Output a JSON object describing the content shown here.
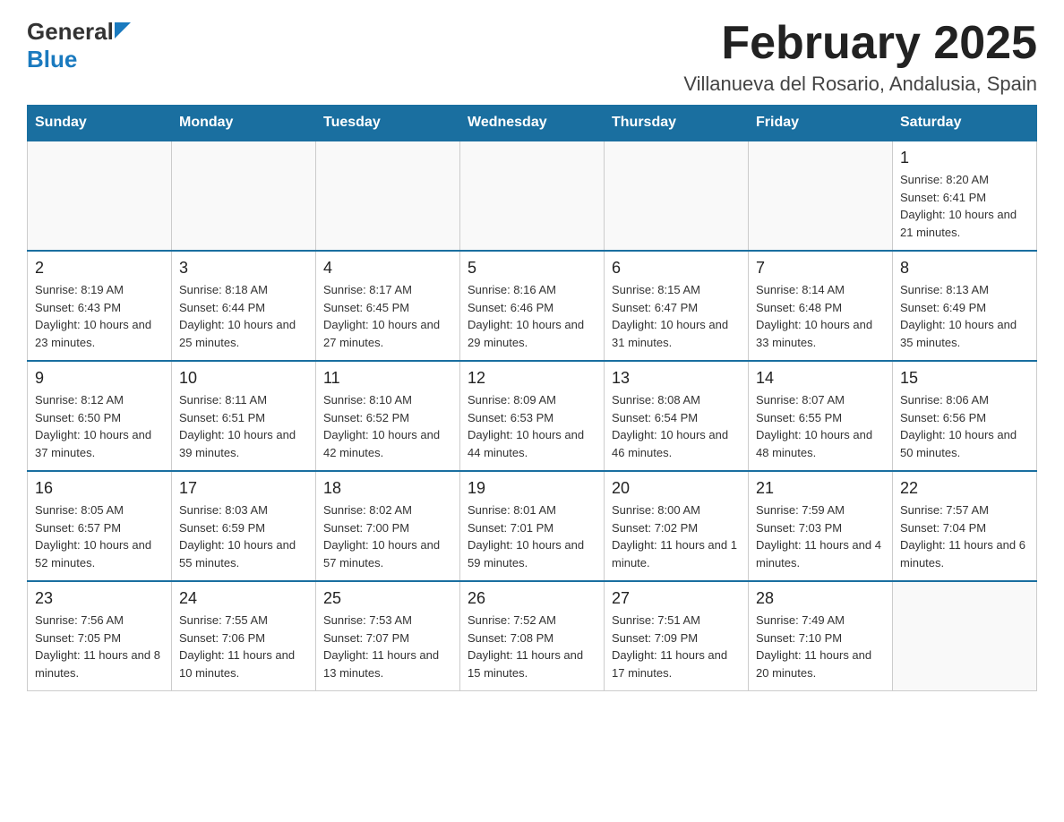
{
  "header": {
    "logo": {
      "text_general": "General",
      "text_blue": "Blue"
    },
    "month_title": "February 2025",
    "location": "Villanueva del Rosario, Andalusia, Spain"
  },
  "days_of_week": [
    "Sunday",
    "Monday",
    "Tuesday",
    "Wednesday",
    "Thursday",
    "Friday",
    "Saturday"
  ],
  "weeks": [
    {
      "days": [
        {
          "num": "",
          "info": ""
        },
        {
          "num": "",
          "info": ""
        },
        {
          "num": "",
          "info": ""
        },
        {
          "num": "",
          "info": ""
        },
        {
          "num": "",
          "info": ""
        },
        {
          "num": "",
          "info": ""
        },
        {
          "num": "1",
          "info": "Sunrise: 8:20 AM\nSunset: 6:41 PM\nDaylight: 10 hours and 21 minutes."
        }
      ]
    },
    {
      "days": [
        {
          "num": "2",
          "info": "Sunrise: 8:19 AM\nSunset: 6:43 PM\nDaylight: 10 hours and 23 minutes."
        },
        {
          "num": "3",
          "info": "Sunrise: 8:18 AM\nSunset: 6:44 PM\nDaylight: 10 hours and 25 minutes."
        },
        {
          "num": "4",
          "info": "Sunrise: 8:17 AM\nSunset: 6:45 PM\nDaylight: 10 hours and 27 minutes."
        },
        {
          "num": "5",
          "info": "Sunrise: 8:16 AM\nSunset: 6:46 PM\nDaylight: 10 hours and 29 minutes."
        },
        {
          "num": "6",
          "info": "Sunrise: 8:15 AM\nSunset: 6:47 PM\nDaylight: 10 hours and 31 minutes."
        },
        {
          "num": "7",
          "info": "Sunrise: 8:14 AM\nSunset: 6:48 PM\nDaylight: 10 hours and 33 minutes."
        },
        {
          "num": "8",
          "info": "Sunrise: 8:13 AM\nSunset: 6:49 PM\nDaylight: 10 hours and 35 minutes."
        }
      ]
    },
    {
      "days": [
        {
          "num": "9",
          "info": "Sunrise: 8:12 AM\nSunset: 6:50 PM\nDaylight: 10 hours and 37 minutes."
        },
        {
          "num": "10",
          "info": "Sunrise: 8:11 AM\nSunset: 6:51 PM\nDaylight: 10 hours and 39 minutes."
        },
        {
          "num": "11",
          "info": "Sunrise: 8:10 AM\nSunset: 6:52 PM\nDaylight: 10 hours and 42 minutes."
        },
        {
          "num": "12",
          "info": "Sunrise: 8:09 AM\nSunset: 6:53 PM\nDaylight: 10 hours and 44 minutes."
        },
        {
          "num": "13",
          "info": "Sunrise: 8:08 AM\nSunset: 6:54 PM\nDaylight: 10 hours and 46 minutes."
        },
        {
          "num": "14",
          "info": "Sunrise: 8:07 AM\nSunset: 6:55 PM\nDaylight: 10 hours and 48 minutes."
        },
        {
          "num": "15",
          "info": "Sunrise: 8:06 AM\nSunset: 6:56 PM\nDaylight: 10 hours and 50 minutes."
        }
      ]
    },
    {
      "days": [
        {
          "num": "16",
          "info": "Sunrise: 8:05 AM\nSunset: 6:57 PM\nDaylight: 10 hours and 52 minutes."
        },
        {
          "num": "17",
          "info": "Sunrise: 8:03 AM\nSunset: 6:59 PM\nDaylight: 10 hours and 55 minutes."
        },
        {
          "num": "18",
          "info": "Sunrise: 8:02 AM\nSunset: 7:00 PM\nDaylight: 10 hours and 57 minutes."
        },
        {
          "num": "19",
          "info": "Sunrise: 8:01 AM\nSunset: 7:01 PM\nDaylight: 10 hours and 59 minutes."
        },
        {
          "num": "20",
          "info": "Sunrise: 8:00 AM\nSunset: 7:02 PM\nDaylight: 11 hours and 1 minute."
        },
        {
          "num": "21",
          "info": "Sunrise: 7:59 AM\nSunset: 7:03 PM\nDaylight: 11 hours and 4 minutes."
        },
        {
          "num": "22",
          "info": "Sunrise: 7:57 AM\nSunset: 7:04 PM\nDaylight: 11 hours and 6 minutes."
        }
      ]
    },
    {
      "days": [
        {
          "num": "23",
          "info": "Sunrise: 7:56 AM\nSunset: 7:05 PM\nDaylight: 11 hours and 8 minutes."
        },
        {
          "num": "24",
          "info": "Sunrise: 7:55 AM\nSunset: 7:06 PM\nDaylight: 11 hours and 10 minutes."
        },
        {
          "num": "25",
          "info": "Sunrise: 7:53 AM\nSunset: 7:07 PM\nDaylight: 11 hours and 13 minutes."
        },
        {
          "num": "26",
          "info": "Sunrise: 7:52 AM\nSunset: 7:08 PM\nDaylight: 11 hours and 15 minutes."
        },
        {
          "num": "27",
          "info": "Sunrise: 7:51 AM\nSunset: 7:09 PM\nDaylight: 11 hours and 17 minutes."
        },
        {
          "num": "28",
          "info": "Sunrise: 7:49 AM\nSunset: 7:10 PM\nDaylight: 11 hours and 20 minutes."
        },
        {
          "num": "",
          "info": ""
        }
      ]
    }
  ]
}
